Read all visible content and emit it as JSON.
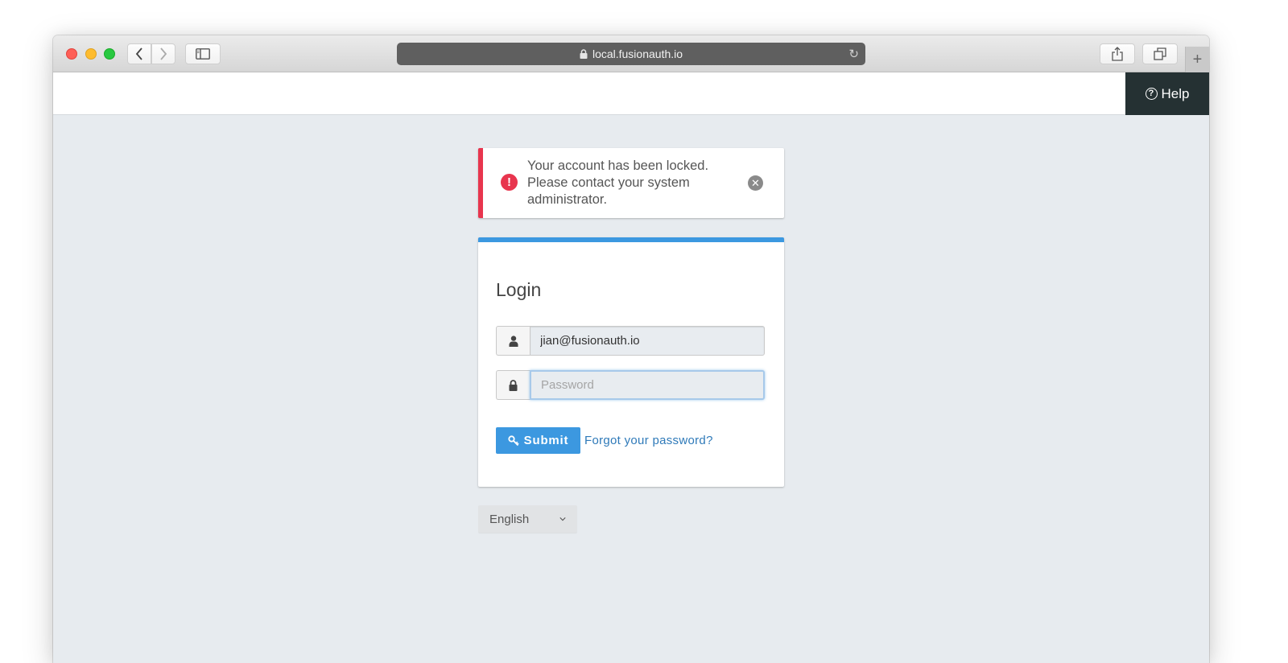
{
  "browser": {
    "url": "local.fusionauth.io",
    "nav": {
      "back_icon": "chevron-left-icon",
      "forward_icon": "chevron-right-icon",
      "sidebar_icon": "sidebar-icon",
      "share_icon": "share-icon",
      "tabs_icon": "tabs-overview-icon",
      "new_tab_label": "+"
    }
  },
  "header": {
    "help_label": "Help",
    "help_icon": "question-circle-icon"
  },
  "alert": {
    "type": "error",
    "message": "Your account has been locked. Please contact your system administrator.",
    "icon": "exclamation-circle-icon",
    "close_icon": "close-circle-icon",
    "accent_color": "#e8354e"
  },
  "login": {
    "title": "Login",
    "accent_color": "#3c98e0",
    "login_field": {
      "value": "jian@fusionauth.io",
      "icon": "user-icon"
    },
    "password_field": {
      "value": "",
      "placeholder": "Password",
      "icon": "lock-icon"
    },
    "submit_label": "Submit",
    "submit_icon": "key-icon",
    "forgot_password_label": "Forgot your password?"
  },
  "locale": {
    "selected": "English"
  }
}
